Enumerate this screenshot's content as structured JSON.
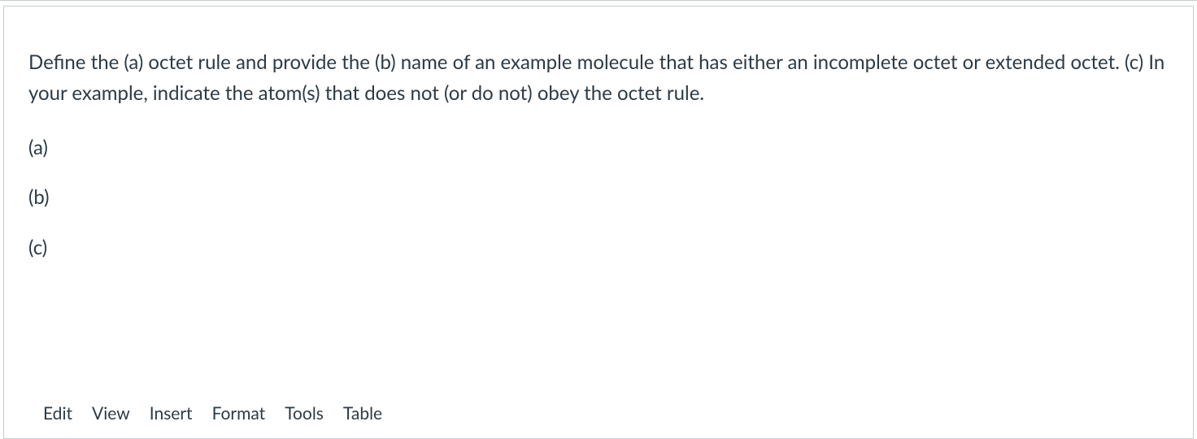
{
  "question": {
    "prompt": "Define the (a) octet rule and provide the (b) name of an example molecule that has either an incomplete octet or extended octet.   (c) In your example, indicate the atom(s) that does not (or do not) obey the octet rule.",
    "parts": {
      "a": "(a)",
      "b": "(b)",
      "c": "(c)"
    }
  },
  "editor": {
    "menu": {
      "edit": "Edit",
      "view": "View",
      "insert": "Insert",
      "format": "Format",
      "tools": "Tools",
      "table": "Table"
    }
  }
}
